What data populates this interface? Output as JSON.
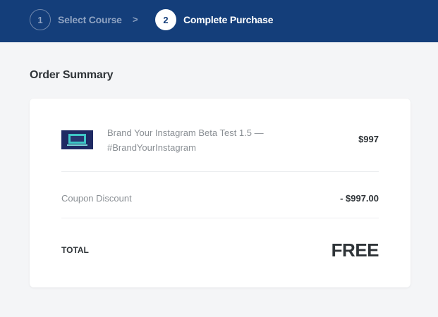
{
  "stepper": {
    "steps": [
      {
        "number": "1",
        "label": "Select Course",
        "state": "completed"
      },
      {
        "number": "2",
        "label": "Complete Purchase",
        "state": "active"
      }
    ],
    "separator": ">"
  },
  "order_summary": {
    "title": "Order Summary",
    "product": {
      "thumbnail_icon": "course-thumbnail",
      "name": "Brand Your Instagram Beta Test 1.5 — #BrandYourInstagram",
      "price": "$997"
    },
    "coupon": {
      "label": "Coupon Discount",
      "amount": "- $997.00"
    },
    "total": {
      "label": "TOTAL",
      "value": "FREE"
    }
  },
  "colors": {
    "header_bg": "#143e7a",
    "page_bg": "#f4f5f7",
    "card_bg": "#ffffff"
  }
}
